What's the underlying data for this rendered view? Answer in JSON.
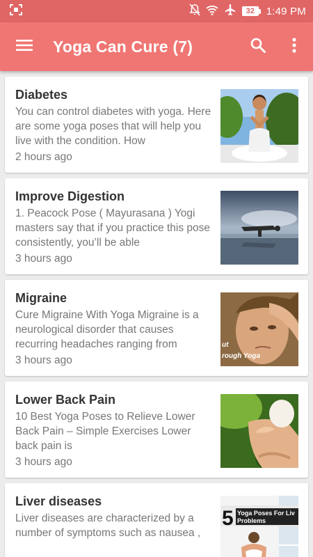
{
  "status_bar": {
    "battery": "32",
    "time": "1:49 PM"
  },
  "app_bar": {
    "title": "Yoga Can Cure (7)"
  },
  "articles": [
    {
      "title": "Diabetes",
      "excerpt": "You can control diabetes with yoga. Here are some yoga poses that will help you live with the condition. How",
      "time": "2 hours ago"
    },
    {
      "title": "Improve Digestion",
      "excerpt": "1. Peacock Pose ( Mayurasana ) Yogi masters say that if you practice this pose consistently, you’ll be able",
      "time": "3 hours ago"
    },
    {
      "title": "Migraine",
      "excerpt": "Cure Migraine With Yoga Migraine is a neurological disorder that causes recurring headaches ranging from",
      "time": "3 hours ago",
      "image_text": [
        "ut",
        "rough Yoga"
      ]
    },
    {
      "title": "Lower Back Pain",
      "excerpt": "10 Best Yoga Poses to Relieve Lower  Back Pain – Simple Exercises  Lower back pain is",
      "time": "3 hours ago"
    },
    {
      "title": "Liver diseases",
      "excerpt": "Liver diseases  are characterized by a number of symptoms such as nausea ,",
      "time": "",
      "image_text": [
        "5",
        "Yoga Poses For Liv",
        "Problems"
      ]
    }
  ],
  "colors": {
    "status_bar": "#e06666",
    "app_bar": "#f07673"
  }
}
